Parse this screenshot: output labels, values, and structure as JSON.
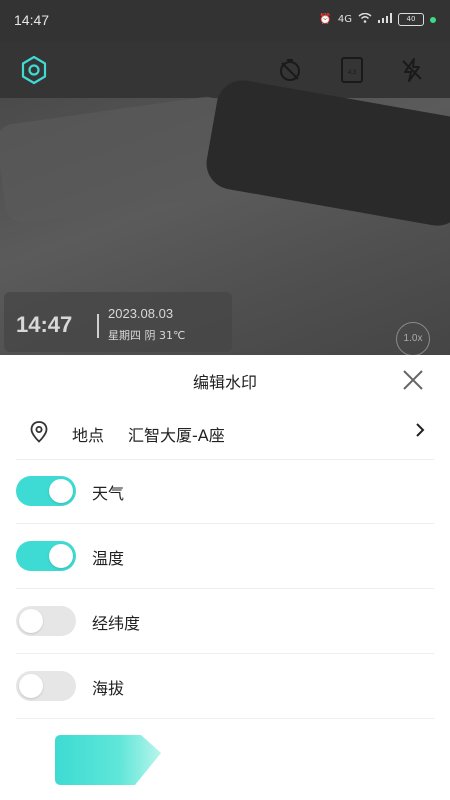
{
  "status_bar": {
    "time": "14:47",
    "battery": "40",
    "network": "4G"
  },
  "camera": {
    "settings_icon": "gear-icon",
    "timer_icon": "timer-off-icon",
    "aspect_icon": "aspect-ratio-icon",
    "flash_icon": "flash-off-icon",
    "watermark": {
      "time": "14:47",
      "date": "2023.08.03",
      "weather": "星期四 阴 31℃"
    },
    "zoom": "1.0x"
  },
  "sheet": {
    "title": "编辑水印",
    "location": {
      "label": "地点",
      "value": "汇智大厦-A座"
    },
    "toggles": [
      {
        "label": "天气",
        "on": true
      },
      {
        "label": "温度",
        "on": true
      },
      {
        "label": "经纬度",
        "on": false
      },
      {
        "label": "海拔",
        "on": false
      }
    ]
  },
  "colors": {
    "accent": "#3ddbd3",
    "toggle_off": "#e6e6e6"
  }
}
